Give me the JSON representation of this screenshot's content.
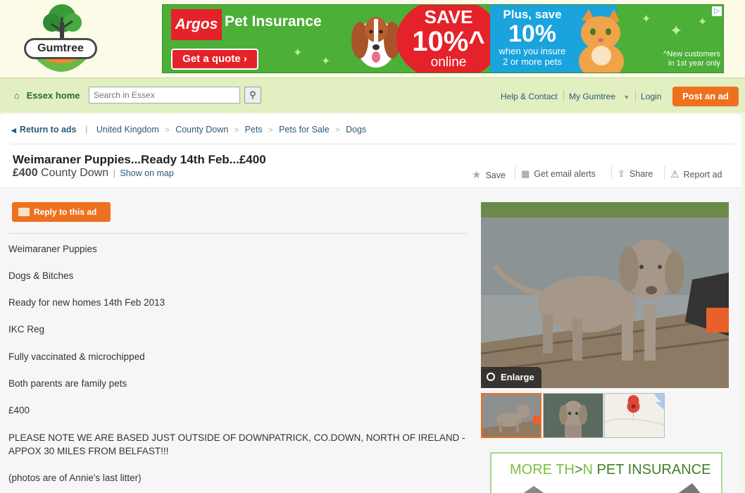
{
  "logo": {
    "text": "Gumtree"
  },
  "banner": {
    "argos": "Argos",
    "pet_insurance": "Pet Insurance",
    "get_quote": "Get a quote ›",
    "save_l1": "SAVE",
    "save_l2": "10%^",
    "save_l3": "online",
    "plus_l1": "Plus, save",
    "plus_l2": "10%",
    "plus_l3": "when you insure",
    "plus_l4": "2 or more pets",
    "new_cust_l1": "^New customers",
    "new_cust_l2": "in 1st year only",
    "colors": {
      "green": "#4caf38",
      "red": "#e52129",
      "blue": "#1aa3dc"
    }
  },
  "nav": {
    "home": "Essex home",
    "search_placeholder": "Search in Essex",
    "help": "Help & Contact",
    "my_gumtree": "My Gumtree",
    "login": "Login",
    "post_ad": "Post an ad"
  },
  "breadcrumbs": {
    "return": "Return to ads",
    "items": [
      "United Kingdom",
      "County Down",
      "Pets",
      "Pets for Sale",
      "Dogs"
    ]
  },
  "ad": {
    "title": "Weimaraner Puppies...Ready 14th Feb...£400",
    "price": "£400",
    "location": "County Down",
    "show_map": "Show on map",
    "actions": {
      "save": "Save",
      "alerts": "Get email alerts",
      "share": "Share",
      "report": "Report ad"
    },
    "reply": "Reply to this ad",
    "description": [
      "Weimaraner Puppies",
      "Dogs & Bitches",
      "Ready for new homes 14th Feb 2013",
      "IKC Reg",
      "Fully vaccinated & microchipped",
      "Both parents are family pets",
      "£400",
      "PLEASE NOTE WE ARE BASED JUST OUTSIDE OF DOWNPATRICK, CO.DOWN, NORTH OF IRELAND - APPOX 30 MILES FROM BELFAST!!!",
      "(photos are of Annie's last litter)"
    ],
    "enlarge": "Enlarge"
  },
  "side_ad": {
    "more": "MORE TH",
    "gt": ">",
    "n": "N",
    "rest": " PET INSURANCE"
  },
  "accent": "#ee7120"
}
